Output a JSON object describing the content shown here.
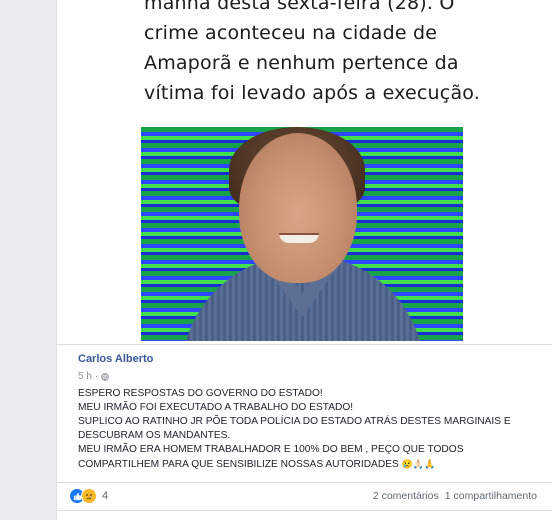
{
  "shared_post": {
    "text_lines": [
      "manhã desta sexta-feira (28). O",
      "crime aconteceu na cidade de",
      "Amaporã e nenhum pertence da",
      "vítima foi levado após a execução."
    ]
  },
  "comment": {
    "author": "Carlos Alberto",
    "time": "5 h",
    "separator": "·",
    "privacy_icon": "globe-icon",
    "message_lines": [
      "ESPERO RESPOSTAS DO GOVERNO DO ESTADO!",
      "MEU IRMÃO FOI EXECUTADO A TRABALHO DO ESTADO!",
      "SUPLICO AO RATINHO JR PÕE TODA POLÍCIA DO ESTADO ATRÁS DESTES MARGINAIS E",
      "DESCUBRAM OS MANDANTES.",
      "MEU IRMÃO ERA HOMEM TRABALHADOR E 100% DO BEM , PEÇO QUE TODOS",
      "COMPARTILHEM PARA QUE SENSIBILIZE NOSSAS AUTORIDADES "
    ],
    "emojis": "😢🙏🏻🙏"
  },
  "stats": {
    "reaction_count": "4",
    "comments": "2 comentários",
    "shares": "1 compartilhamento"
  },
  "colors": {
    "link_blue": "#385898",
    "like_blue": "#1877f2",
    "sad_yellow": "#f7b928"
  }
}
